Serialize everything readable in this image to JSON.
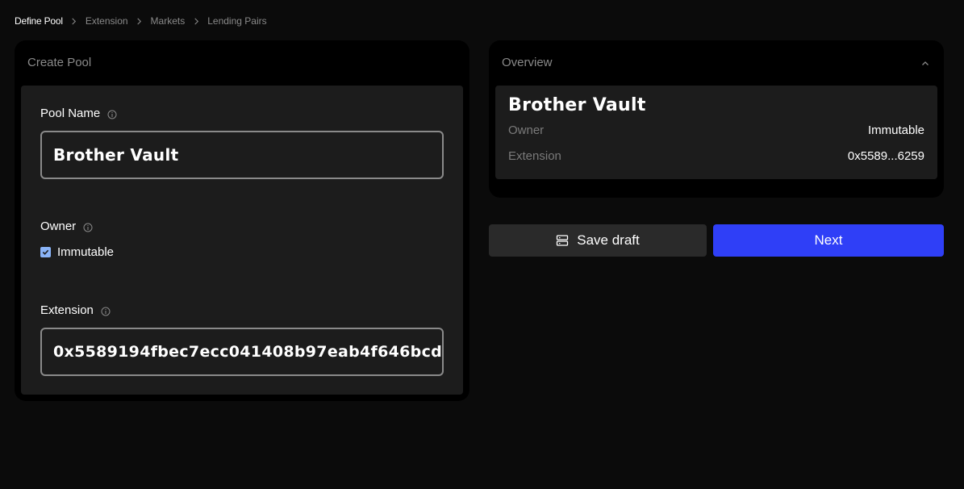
{
  "breadcrumb": {
    "items": [
      {
        "label": "Define Pool",
        "active": true
      },
      {
        "label": "Extension",
        "active": false
      },
      {
        "label": "Markets",
        "active": false
      },
      {
        "label": "Lending Pairs",
        "active": false
      }
    ],
    "separator_icon": "chevron-right-icon"
  },
  "create_pool": {
    "title": "Create Pool",
    "pool_name": {
      "label": "Pool Name",
      "value": "Brother Vault",
      "info_icon": "info-icon"
    },
    "owner": {
      "label": "Owner",
      "checkbox_label": "Immutable",
      "checked": true,
      "info_icon": "info-icon"
    },
    "extension": {
      "label": "Extension",
      "value": "0x5589194fbec7ecc041408b97eab4f646bcd",
      "info_icon": "info-icon"
    }
  },
  "overview": {
    "title": "Overview",
    "collapse_icon": "chevron-up-icon",
    "pool_name": "Brother Vault",
    "rows": [
      {
        "key": "Owner",
        "value": "Immutable"
      },
      {
        "key": "Extension",
        "value": "0x5589...6259"
      }
    ]
  },
  "actions": {
    "save_label": "Save draft",
    "save_icon": "server-icon",
    "next_label": "Next"
  },
  "colors": {
    "background": "#0b0b0b",
    "card": "#000000",
    "inner": "#1c1c1c",
    "primary": "#2f3ff7",
    "secondary_button": "#2a2a2a",
    "muted_text": "#8a8a8a",
    "checkbox": "#8ab4f8"
  }
}
